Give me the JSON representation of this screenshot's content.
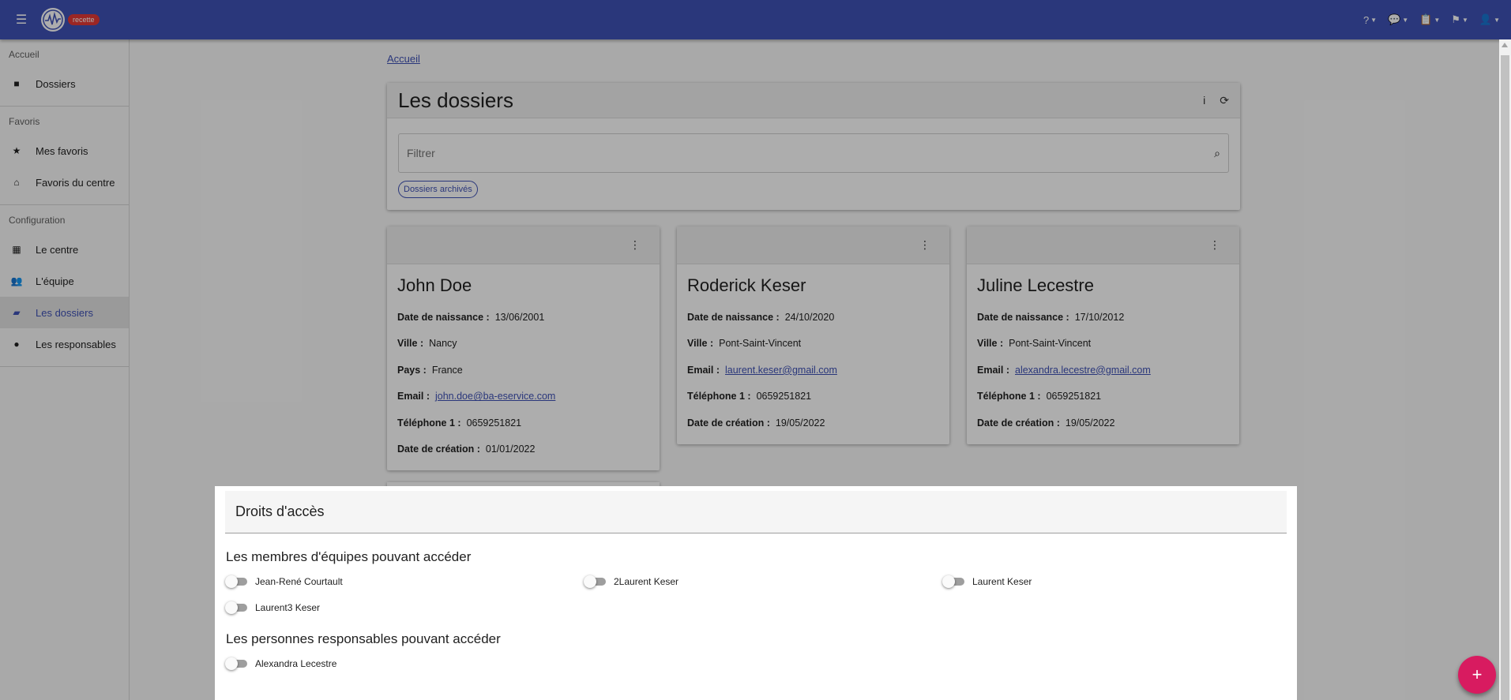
{
  "app": {
    "badge": "recette"
  },
  "header": {
    "icons": [
      "help-icon",
      "chat-icon",
      "clipboard-icon",
      "flag-icon",
      "user-icon"
    ]
  },
  "sidebar": {
    "sections": [
      {
        "header": "Accueil",
        "items": [
          {
            "label": "Dossiers",
            "icon": "folder-icon"
          }
        ]
      },
      {
        "header": "Favoris",
        "items": [
          {
            "label": "Mes favoris",
            "icon": "star-icon"
          },
          {
            "label": "Favoris du centre",
            "icon": "warehouse-icon"
          }
        ]
      },
      {
        "header": "Configuration",
        "items": [
          {
            "label": "Le centre",
            "icon": "building-icon"
          },
          {
            "label": "L'équipe",
            "icon": "users-icon"
          },
          {
            "label": "Les dossiers",
            "icon": "folder-open-icon",
            "active": true
          },
          {
            "label": "Les responsables",
            "icon": "user-icon"
          }
        ]
      }
    ]
  },
  "breadcrumb": "Accueil",
  "panel": {
    "title": "Les dossiers",
    "filter_placeholder": "Filtrer",
    "chip": "Dossiers archivés"
  },
  "cards": [
    {
      "name": "John Doe",
      "fields": [
        {
          "label": "Date de naissance :",
          "value": "13/06/2001"
        },
        {
          "label": "Ville :",
          "value": "Nancy"
        },
        {
          "label": "Pays :",
          "value": "France"
        },
        {
          "label": "Email :",
          "value": "john.doe@ba-eservice.com",
          "link": true
        },
        {
          "label": "Téléphone 1 :",
          "value": "0659251821"
        },
        {
          "label": "Date de création :",
          "value": "01/01/2022"
        }
      ]
    },
    {
      "name": "Roderick Keser",
      "fields": [
        {
          "label": "Date de naissance :",
          "value": "24/10/2020"
        },
        {
          "label": "Ville :",
          "value": "Pont-Saint-Vincent"
        },
        {
          "label": "Email :",
          "value": "laurent.keser@gmail.com",
          "link": true
        },
        {
          "label": "Téléphone 1 :",
          "value": "0659251821"
        },
        {
          "label": "Date de création :",
          "value": "19/05/2022"
        }
      ]
    },
    {
      "name": "Juline Lecestre",
      "fields": [
        {
          "label": "Date de naissance :",
          "value": "17/10/2012"
        },
        {
          "label": "Ville :",
          "value": "Pont-Saint-Vincent"
        },
        {
          "label": "Email :",
          "value": "alexandra.lecestre@gmail.com",
          "link": true
        },
        {
          "label": "Téléphone 1 :",
          "value": "0659251821"
        },
        {
          "label": "Date de création :",
          "value": "19/05/2022"
        }
      ]
    }
  ],
  "dialog": {
    "title": "Droits d'accès",
    "team_title": "Les membres d'équipes pouvant accéder",
    "team_members": [
      {
        "name": "Jean-René Courtault",
        "enabled": false
      },
      {
        "name": "2Laurent Keser",
        "enabled": false
      },
      {
        "name": "Laurent Keser",
        "enabled": false
      },
      {
        "name": "Laurent3 Keser",
        "enabled": false
      }
    ],
    "resp_title": "Les personnes responsables pouvant accéder",
    "responsables": [
      {
        "name": "Alexandra Lecestre",
        "enabled": false
      }
    ]
  },
  "fab": {
    "label": "+"
  },
  "colors": {
    "primary": "#3f51b5",
    "accent": "#d81b60",
    "badge": "#e53935"
  }
}
